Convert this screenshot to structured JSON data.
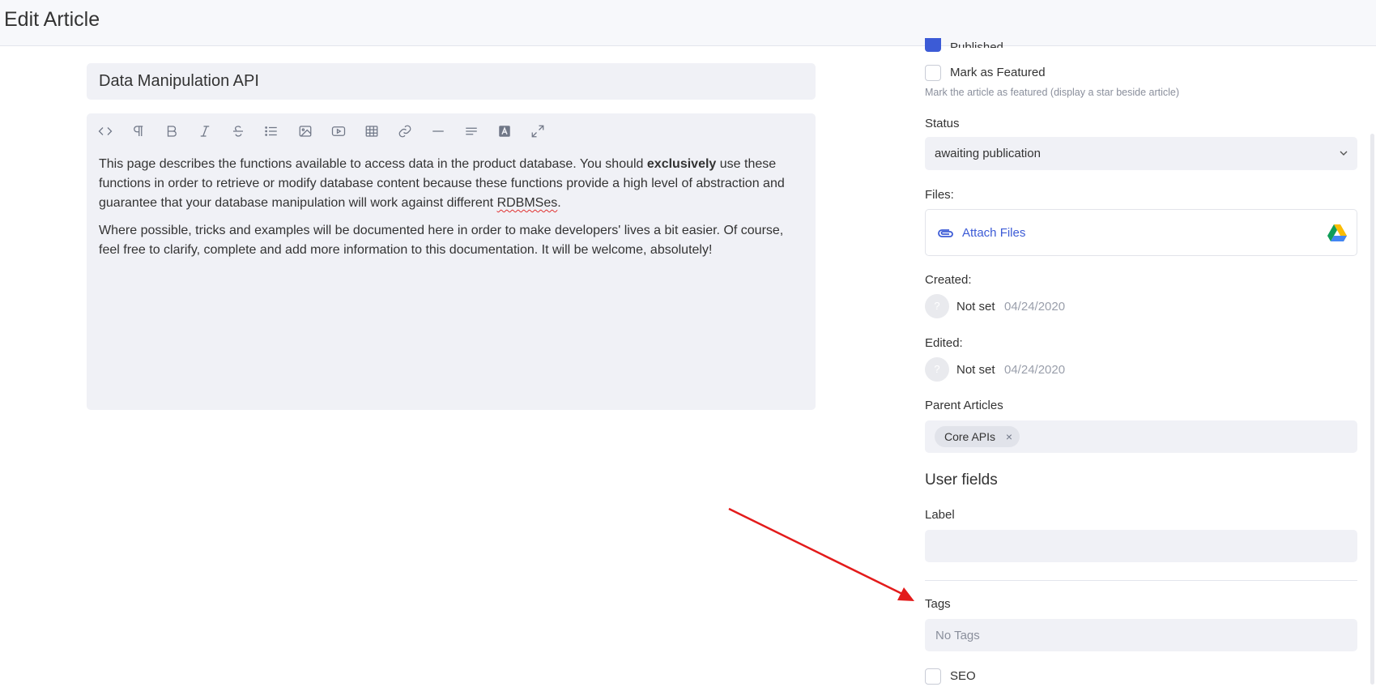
{
  "header": {
    "title": "Edit Article"
  },
  "article": {
    "title": "Data Manipulation API",
    "paragraph1_a": "This page describes the functions available to access data in the product database. You should ",
    "paragraph1_bold": "exclusively",
    "paragraph1_b": " use these functions in order to retrieve or modify database content because these functions provide a high level of abstraction and guarantee that your database manipulation will work against different ",
    "paragraph1_misspelled": "RDBMSes",
    "paragraph1_c": ".",
    "paragraph2": "Where possible, tricks and examples will be documented here in order to make developers' lives a bit easier. Of course, feel free to clarify, complete and add more information to this documentation. It will be welcome, absolutely!"
  },
  "toolbar": {
    "icons": [
      "code-icon",
      "paragraph-icon",
      "bold-icon",
      "italic-icon",
      "strikethrough-icon",
      "list-icon",
      "image-icon",
      "video-icon",
      "table-icon",
      "link-icon",
      "horizontal-rule-icon",
      "align-icon",
      "text-color-icon",
      "fullscreen-icon"
    ]
  },
  "sidebar": {
    "published_label": "Published",
    "featured_label": "Mark as Featured",
    "featured_hint": "Mark the article as featured (display a star beside article)",
    "status_label": "Status",
    "status_value": "awaiting publication",
    "files_label": "Files:",
    "attach_label": "Attach Files",
    "created_label": "Created:",
    "created_by": "Not set",
    "created_date": "04/24/2020",
    "edited_label": "Edited:",
    "edited_by": "Not set",
    "edited_date": "04/24/2020",
    "avatar_placeholder": "?",
    "parent_label": "Parent Articles",
    "parent_chip": "Core APIs",
    "parent_chip_remove": "×",
    "user_fields_title": "User fields",
    "label_label": "Label",
    "tags_label": "Tags",
    "tags_placeholder": "No Tags",
    "seo_label": "SEO"
  },
  "colors": {
    "accent": "#3c5bd6",
    "arrow": "#e31b1b",
    "field_bg": "#f0f1f6"
  }
}
